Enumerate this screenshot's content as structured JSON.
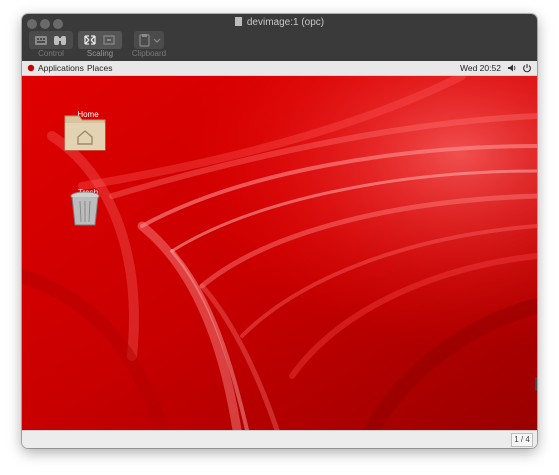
{
  "window": {
    "title": "devimage:1 (opc)"
  },
  "toolbar": {
    "control_label": "Control",
    "scaling_label": "Scaling",
    "clipboard_label": "Clipboard"
  },
  "topbar": {
    "applications_label": "Applications",
    "places_label": "Places",
    "clock": "Wed 20:52"
  },
  "desktop": {
    "icons": [
      {
        "label": "Home"
      },
      {
        "label": "Trash"
      }
    ]
  },
  "status": {
    "page_indicator": "1 / 4"
  },
  "colors": {
    "desktop_red": "#cc0000",
    "titlebar": "#3a3a3a"
  }
}
